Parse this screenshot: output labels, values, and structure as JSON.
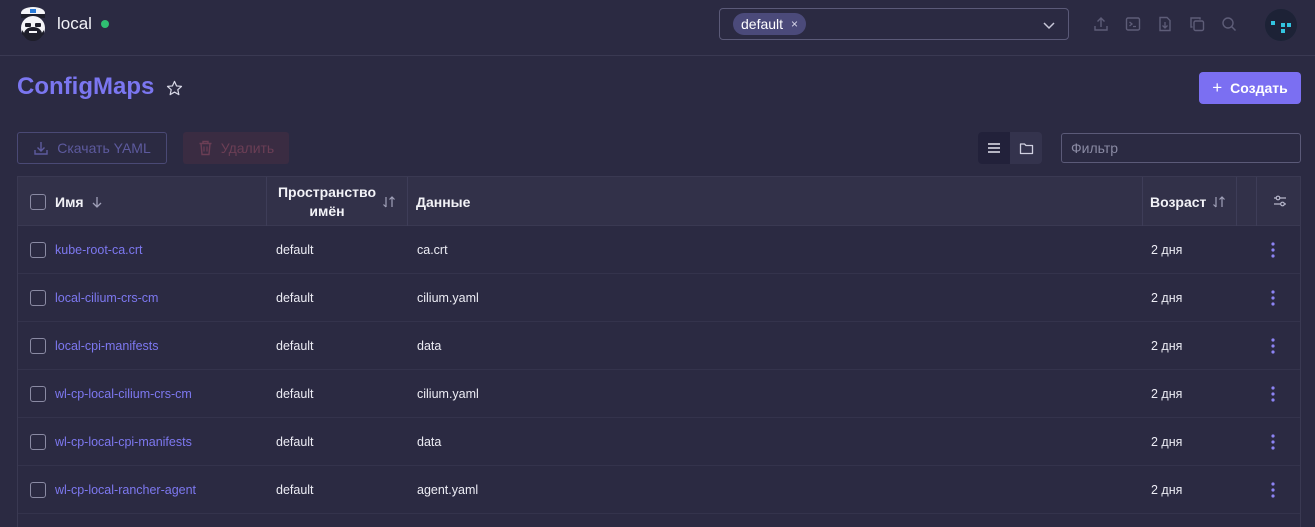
{
  "header": {
    "cluster_name": "local",
    "status_color": "#2fbf71",
    "namespace_chip": "default",
    "chip_remove": "×",
    "icons": [
      "upload-icon",
      "terminal-icon",
      "import-file-icon",
      "copy-icon",
      "search-icon"
    ]
  },
  "page": {
    "title": "ConfigMaps",
    "create_label": "Создать",
    "create_plus": "+",
    "download_yaml_label": "Скачать YAML",
    "delete_label": "Удалить",
    "filter_placeholder": "Фильтр"
  },
  "table": {
    "columns": {
      "name": "Имя",
      "namespace_line1": "Пространство",
      "namespace_line2": "имён",
      "data": "Данные",
      "age": "Возраст"
    },
    "rows": [
      {
        "name": "kube-root-ca.crt",
        "namespace": "default",
        "data": "ca.crt",
        "age": "2 дня"
      },
      {
        "name": "local-cilium-crs-cm",
        "namespace": "default",
        "data": "cilium.yaml",
        "age": "2 дня"
      },
      {
        "name": "local-cpi-manifests",
        "namespace": "default",
        "data": "data",
        "age": "2 дня"
      },
      {
        "name": "wl-cp-local-cilium-crs-cm",
        "namespace": "default",
        "data": "cilium.yaml",
        "age": "2 дня"
      },
      {
        "name": "wl-cp-local-cpi-manifests",
        "namespace": "default",
        "data": "data",
        "age": "2 дня"
      },
      {
        "name": "wl-cp-local-rancher-agent",
        "namespace": "default",
        "data": "agent.yaml",
        "age": "2 дня"
      }
    ]
  },
  "colors": {
    "accent": "#7b6ff2",
    "link": "#7d78f0",
    "background": "#2b2a42"
  }
}
